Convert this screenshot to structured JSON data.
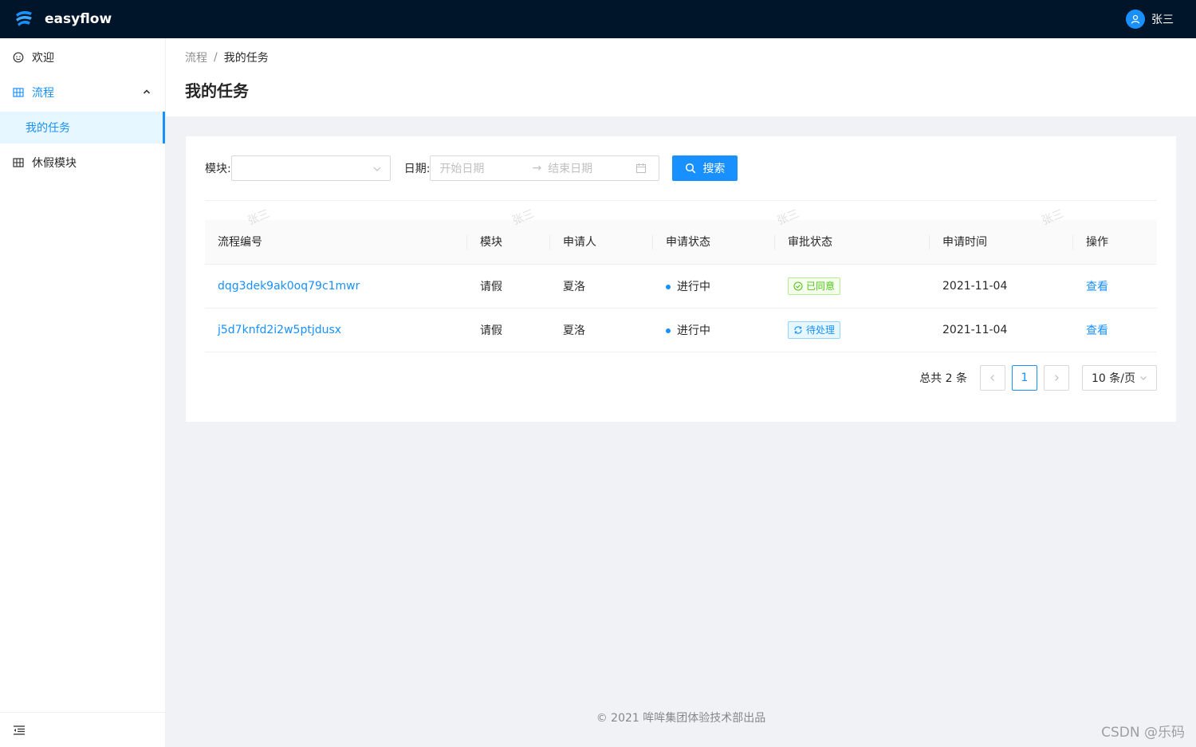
{
  "brand": {
    "name": "easyflow"
  },
  "user": {
    "name": "张三"
  },
  "sidebar": {
    "items": [
      {
        "label": "欢迎"
      },
      {
        "label": "流程",
        "children": [
          {
            "label": "我的任务"
          }
        ]
      },
      {
        "label": "休假模块"
      }
    ]
  },
  "breadcrumb": {
    "parent": "流程",
    "separator": "/",
    "current": "我的任务"
  },
  "page": {
    "title": "我的任务"
  },
  "filters": {
    "module_label": "模块:",
    "date_label": "日期:",
    "start_placeholder": "开始日期",
    "end_placeholder": "结束日期",
    "search_label": "搜索"
  },
  "table": {
    "columns": [
      "流程编号",
      "模块",
      "申请人",
      "申请状态",
      "审批状态",
      "申请时间",
      "操作"
    ],
    "rows": [
      {
        "id": "dqg3dek9ak0oq79c1mwr",
        "module": "请假",
        "applicant": "夏洛",
        "status": "进行中",
        "approval": "已同意",
        "approval_type": "success",
        "time": "2021-11-04",
        "action": "查看"
      },
      {
        "id": "j5d7knfd2i2w5ptjdusx",
        "module": "请假",
        "applicant": "夏洛",
        "status": "进行中",
        "approval": "待处理",
        "approval_type": "processing",
        "time": "2021-11-04",
        "action": "查看"
      }
    ]
  },
  "pagination": {
    "total": "总共 2 条",
    "current": "1",
    "page_size": "10 条/页"
  },
  "watermark": "张三",
  "footer": {
    "copyright_symbol": "©",
    "text": "2021 哞哞集团体验技术部出品"
  },
  "overlay": {
    "csdn": "CSDN @乐码"
  },
  "colors": {
    "primary": "#1890ff",
    "header_bg": "#001529",
    "success": "#52c41a"
  }
}
